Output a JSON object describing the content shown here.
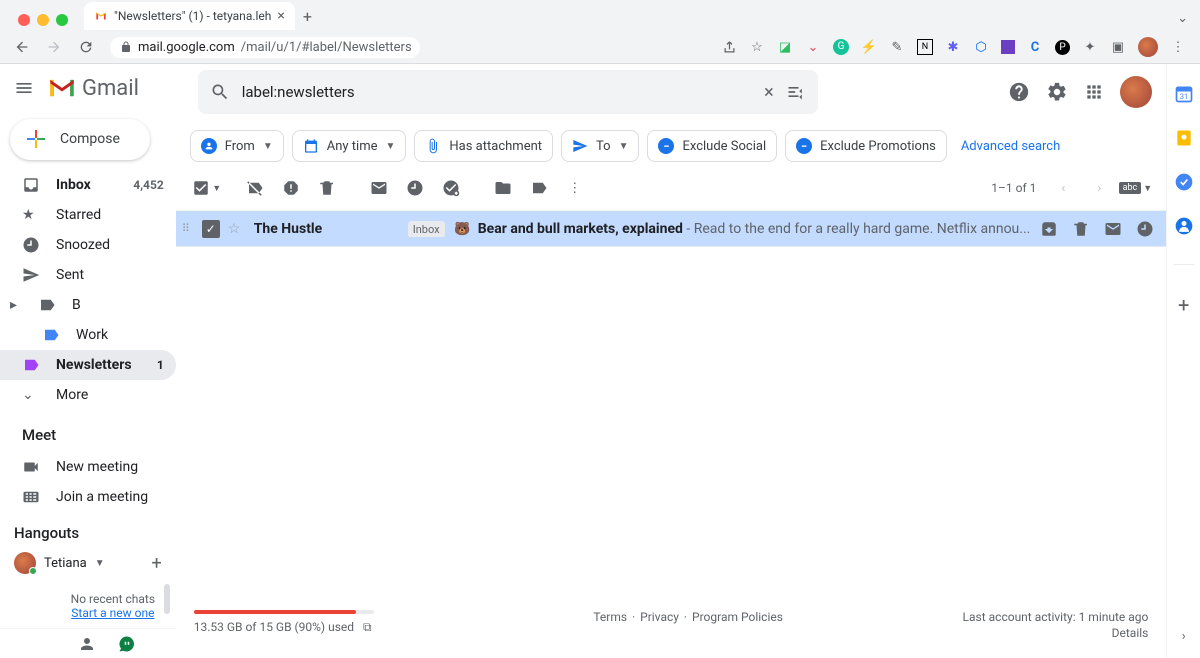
{
  "browser": {
    "tab_title": "\"Newsletters\" (1) - tetyana.leh",
    "url_host": "mail.google.com",
    "url_path": "/mail/u/1/#label/Newsletters"
  },
  "app": {
    "brand": "Gmail",
    "search_value": "label:newsletters",
    "compose": "Compose"
  },
  "sidebar": {
    "items": [
      {
        "label": "Inbox",
        "count": "4,452"
      },
      {
        "label": "Starred"
      },
      {
        "label": "Snoozed"
      },
      {
        "label": "Sent"
      },
      {
        "label": "B"
      },
      {
        "label": "Work"
      },
      {
        "label": "Newsletters",
        "count": "1"
      },
      {
        "label": "More"
      }
    ],
    "meet_header": "Meet",
    "meet_new": "New meeting",
    "meet_join": "Join a meeting",
    "hangouts_header": "Hangouts",
    "hangouts_user": "Tetiana",
    "chat_empty": "No recent chats",
    "chat_start": "Start a new one"
  },
  "filters": {
    "from": "From",
    "anytime": "Any time",
    "attachment": "Has attachment",
    "to": "To",
    "excl_social": "Exclude Social",
    "excl_promo": "Exclude Promotions",
    "advanced": "Advanced search"
  },
  "toolbar": {
    "pager": "1–1 of 1"
  },
  "mail": {
    "sender": "The Hustle",
    "inbox_label": "Inbox",
    "emoji": "🐻",
    "subject": "Bear and bull markets, explained",
    "snippet": " - Read to the end for a really hard game. Netflix annou..."
  },
  "footer": {
    "storage": "13.53 GB of 15 GB (90%) used",
    "storage_pct": 90,
    "terms": "Terms",
    "privacy": "Privacy",
    "policies": "Program Policies",
    "activity": "Last account activity: 1 minute ago",
    "details": "Details"
  }
}
